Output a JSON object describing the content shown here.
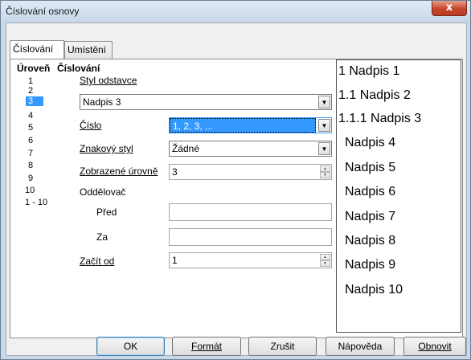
{
  "window": {
    "title": "Číslování osnovy",
    "close_glyph": "x"
  },
  "tabs": [
    {
      "label": "Číslování",
      "active": true
    },
    {
      "label": "Umístění",
      "active": false
    }
  ],
  "level_panel": {
    "heading": "Úroveň",
    "levels": [
      "1",
      "2",
      "3",
      "4",
      "5",
      "6",
      "7",
      "8",
      "9",
      "10",
      "1 - 10"
    ],
    "selected": "3"
  },
  "numbering": {
    "heading": "Číslování",
    "paragraph_style_label": "Styl odstavce",
    "paragraph_style_value": "Nadpis 3",
    "number_label": "Číslo",
    "number_value": "1, 2, 3, ...",
    "char_style_label": "Znakový styl",
    "char_style_value": "Žádné",
    "show_levels_label": "Zobrazené úrovně",
    "show_levels_value": "3",
    "separator_label": "Oddělovač",
    "before_label": "Před",
    "before_value": "",
    "after_label": "Za",
    "after_value": "",
    "start_at_label": "Začít od",
    "start_at_value": "1"
  },
  "preview": [
    "1 Nadpis 1",
    "1.1 Nadpis 2",
    "1.1.1 Nadpis 3",
    "Nadpis 4",
    "Nadpis 5",
    "Nadpis 6",
    "Nadpis 7",
    "Nadpis 8",
    "Nadpis 9",
    "Nadpis 10"
  ],
  "buttons": {
    "ok": "OK",
    "format": "Formát",
    "cancel": "Zrušit",
    "help": "Nápověda",
    "reset": "Obnovit"
  },
  "icons": {
    "dropdown": "chevron-down-icon",
    "spin": "spin-arrows-icon"
  },
  "colors": {
    "selection": "#3399ff",
    "close": "#c8442c",
    "frame": "#c9d9ea"
  }
}
